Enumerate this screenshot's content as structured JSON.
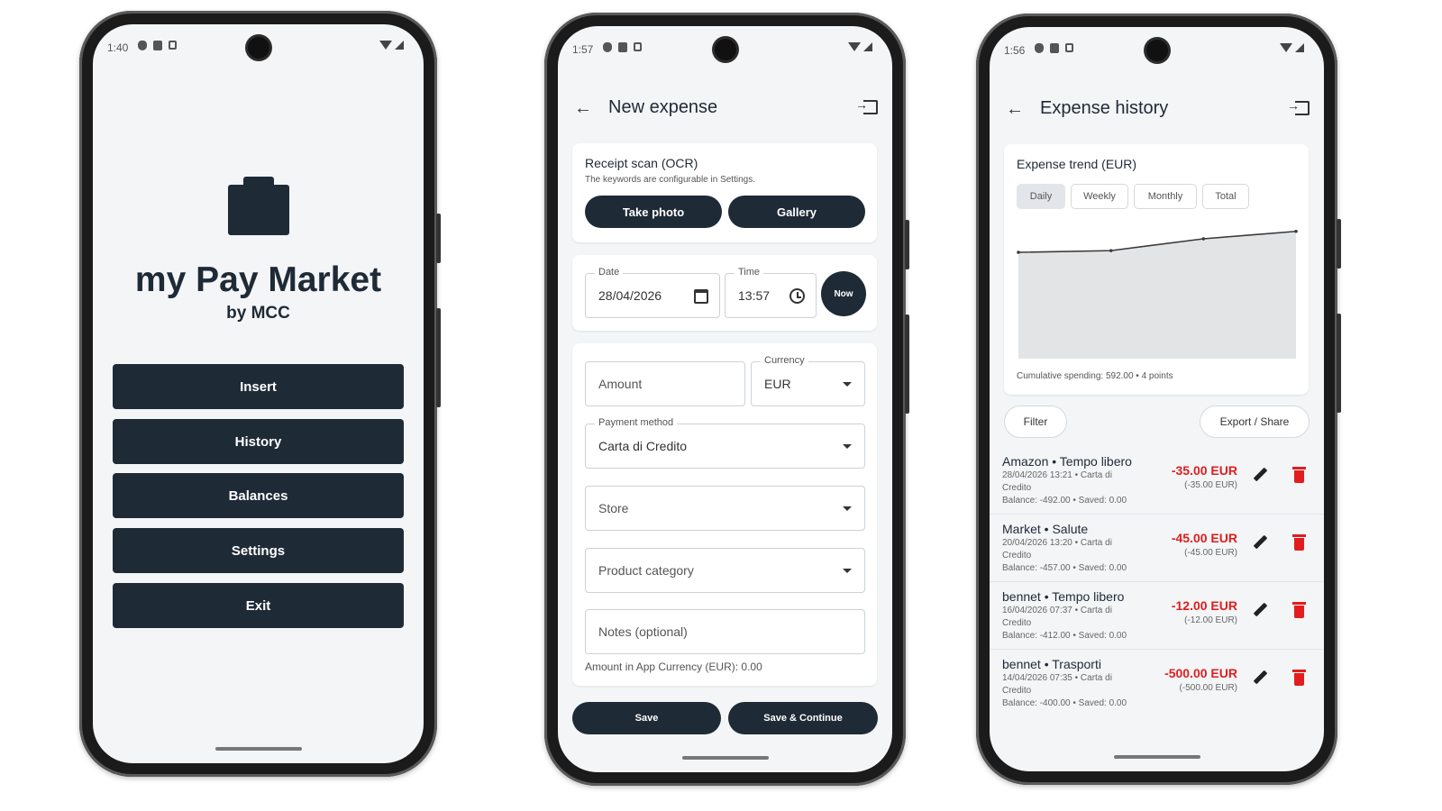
{
  "phone1": {
    "status_time": "1:40",
    "app_title": "my Pay Market",
    "app_subtitle": "by MCC",
    "menu": [
      "Insert",
      "History",
      "Balances",
      "Settings",
      "Exit"
    ]
  },
  "phone2": {
    "status_time": "1:57",
    "title": "New expense",
    "receipt": {
      "title": "Receipt scan (OCR)",
      "subtitle": "The keywords are configurable in Settings.",
      "take_photo": "Take photo",
      "gallery": "Gallery"
    },
    "datetime": {
      "date_label": "Date",
      "date_value": "28/04/2026",
      "time_label": "Time",
      "time_value": "13:57",
      "now": "Now"
    },
    "form": {
      "amount_placeholder": "Amount",
      "currency_label": "Currency",
      "currency_value": "EUR",
      "payment_label": "Payment method",
      "payment_value": "Carta di Credito",
      "store_placeholder": "Store",
      "category_placeholder": "Product category",
      "notes_placeholder": "Notes (optional)",
      "app_currency_line": "Amount in App Currency (EUR): 0.00"
    },
    "save": "Save",
    "save_continue": "Save & Continue"
  },
  "phone3": {
    "status_time": "1:56",
    "title": "Expense history",
    "trend": {
      "title": "Expense trend (EUR)",
      "tabs": [
        "Daily",
        "Weekly",
        "Monthly",
        "Total"
      ],
      "active_tab": 0,
      "caption": "Cumulative spending: 592.00 • 4 points"
    },
    "filter": "Filter",
    "export": "Export / Share",
    "expenses": [
      {
        "title": "Amazon • Tempo libero",
        "meta": "28/04/2026 13:21  •  Carta di Credito",
        "balance": "Balance: -492.00 • Saved: 0.00",
        "amount": "-35.00 EUR",
        "orig": "(-35.00 EUR)"
      },
      {
        "title": "Market • Salute",
        "meta": "20/04/2026 13:20  •  Carta di Credito",
        "balance": "Balance: -457.00 • Saved: 0.00",
        "amount": "-45.00 EUR",
        "orig": "(-45.00 EUR)"
      },
      {
        "title": "bennet • Tempo libero",
        "meta": "16/04/2026 07:37  •  Carta di Credito",
        "balance": "Balance: -412.00 • Saved: 0.00",
        "amount": "-12.00 EUR",
        "orig": "(-12.00 EUR)"
      },
      {
        "title": "bennet • Trasporti",
        "meta": "14/04/2026 07:35  •  Carta di Credito",
        "balance": "Balance: -400.00 • Saved: 0.00",
        "amount": "-500.00 EUR",
        "orig": "(-500.00 EUR)"
      }
    ],
    "chart_data": {
      "type": "area",
      "points": [
        {
          "x": 0,
          "y": 0
        },
        {
          "x": 1,
          "y": 0.05
        },
        {
          "x": 2,
          "y": 0.4
        },
        {
          "x": 3,
          "y": 0.62
        }
      ],
      "fill_color": "#e3e4e6",
      "line_color": "#3a3a3a"
    }
  },
  "colors": {
    "primary": "#1f2a37",
    "danger": "#e11d1d",
    "background": "#f3f5f7"
  }
}
